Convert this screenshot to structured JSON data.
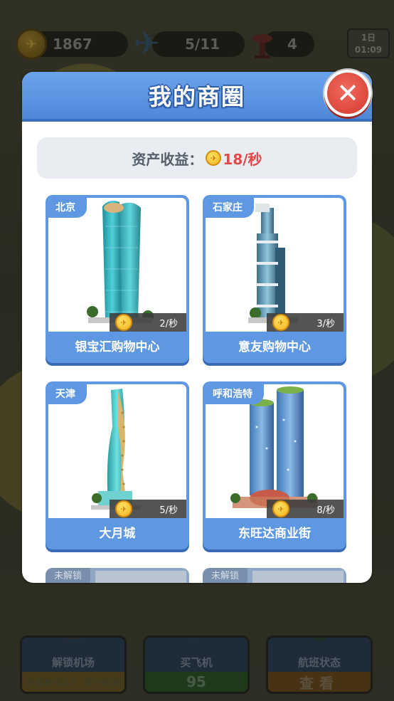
{
  "hud": {
    "coins": "1867",
    "planes": "5/11",
    "towers": "4",
    "day_line1": "1日",
    "day_line2": "01:09"
  },
  "modal": {
    "title": "我的商圈",
    "close_label": "✕",
    "income_label": "资产收益：",
    "income_value": "18/秒"
  },
  "buildings": [
    {
      "city": "北京",
      "name": "银宝汇购物中心",
      "rate": "2/秒"
    },
    {
      "city": "石家庄",
      "name": "意友购物中心",
      "rate": "3/秒"
    },
    {
      "city": "天津",
      "name": "大月城",
      "rate": "5/秒"
    },
    {
      "city": "呼和浩特",
      "name": "东旺达商业街",
      "rate": "8/秒"
    }
  ],
  "locked_cards": [
    {
      "label": "未解锁"
    },
    {
      "label": "未解锁"
    }
  ],
  "bottom_bar": {
    "unlock_airport": {
      "title": "解锁机场",
      "sub": "完成考核13：更长航线"
    },
    "buy_plane": {
      "title": "买飞机",
      "price": "95"
    },
    "flight_status": {
      "title": "航班状态",
      "sub": "查看"
    }
  },
  "colors": {
    "modal_header": "#5f98e2",
    "close_button": "#e04a3e",
    "income_value": "#e5474a",
    "coin": "#f0b21a"
  }
}
